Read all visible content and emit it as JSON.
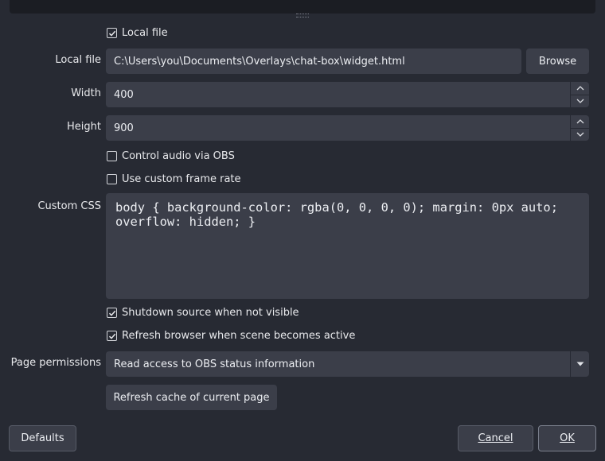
{
  "form": {
    "local_file_checkbox": {
      "label": "Local file",
      "checked": true
    },
    "local_file": {
      "label": "Local file",
      "value": "C:\\Users\\you\\Documents\\Overlays\\chat-box\\widget.html",
      "browse_label": "Browse"
    },
    "width": {
      "label": "Width",
      "value": "400"
    },
    "height": {
      "label": "Height",
      "value": "900"
    },
    "control_audio": {
      "label": "Control audio via OBS",
      "checked": false
    },
    "custom_frame_rate": {
      "label": "Use custom frame rate",
      "checked": false
    },
    "custom_css": {
      "label": "Custom CSS",
      "value": "body { background-color: rgba(0, 0, 0, 0); margin: 0px auto;\noverflow: hidden; }"
    },
    "shutdown_source": {
      "label": "Shutdown source when not visible",
      "checked": true
    },
    "refresh_browser": {
      "label": "Refresh browser when scene becomes active",
      "checked": true
    },
    "page_permissions": {
      "label": "Page permissions",
      "value": "Read access to OBS status information"
    },
    "refresh_cache_label": "Refresh cache of current page"
  },
  "footer": {
    "defaults_label": "Defaults",
    "cancel_label": "Cancel",
    "ok_label": "OK"
  },
  "icons": {
    "checkmark": "checkmark-icon",
    "spin_up": "chevron-up-icon",
    "spin_down": "chevron-down-icon",
    "dropdown": "caret-down-icon",
    "grip": "resize-grip-icon"
  },
  "colors": {
    "background": "#272a33",
    "field": "#3b3e49",
    "preview": "#1b1d23",
    "text": "#e8e9ec"
  }
}
